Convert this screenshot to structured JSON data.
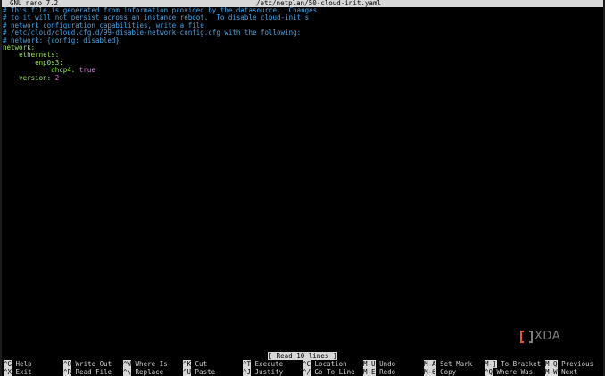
{
  "titlebar": {
    "app": "GNU nano 7.2",
    "file": "/etc/netplan/50-cloud-init.yaml"
  },
  "editor": {
    "lines": [
      {
        "text": "# This file is generated from information provided by the datasource.  Changes",
        "kind": "comment"
      },
      {
        "text": "# to it will not persist across an instance reboot.  To disable cloud-init's",
        "kind": "comment"
      },
      {
        "text": "# network configuration capabilities, write a file",
        "kind": "comment"
      },
      {
        "text": "# /etc/cloud/cloud.cfg.d/99-disable-network-config.cfg with the following:",
        "kind": "comment"
      },
      {
        "text": "# network: {config: disabled}",
        "kind": "comment"
      },
      {
        "key": "network",
        "sep": ":",
        "indent": "",
        "kind": "key"
      },
      {
        "key": "ethernets",
        "sep": ":",
        "indent": "    ",
        "kind": "key"
      },
      {
        "key": "enp0s3",
        "sep": ":",
        "indent": "        ",
        "kind": "key"
      },
      {
        "key": "dhcp4",
        "sep": ": ",
        "value": "true",
        "indent": "            ",
        "kind": "keyval"
      },
      {
        "key": "version",
        "sep": ": ",
        "value": "2",
        "indent": "    ",
        "kind": "keyval"
      }
    ]
  },
  "status": "[ Read 10 lines ]",
  "shortcuts": [
    [
      {
        "key": "^G",
        "label": "Help"
      },
      {
        "key": "^X",
        "label": "Exit"
      }
    ],
    [
      {
        "key": "^O",
        "label": "Write Out"
      },
      {
        "key": "^R",
        "label": "Read File"
      }
    ],
    [
      {
        "key": "^W",
        "label": "Where Is"
      },
      {
        "key": "^\\",
        "label": "Replace"
      }
    ],
    [
      {
        "key": "^K",
        "label": "Cut"
      },
      {
        "key": "^U",
        "label": "Paste"
      }
    ],
    [
      {
        "key": "^T",
        "label": "Execute"
      },
      {
        "key": "^J",
        "label": "Justify"
      }
    ],
    [
      {
        "key": "^C",
        "label": "Location"
      },
      {
        "key": "^/",
        "label": "Go To Line"
      }
    ],
    [
      {
        "key": "M-U",
        "label": "Undo"
      },
      {
        "key": "M-E",
        "label": "Redo"
      }
    ],
    [
      {
        "key": "M-A",
        "label": "Set Mark"
      },
      {
        "key": "M-6",
        "label": "Copy"
      }
    ],
    [
      {
        "key": "M-]",
        "label": "To Bracket"
      },
      {
        "key": "^Q",
        "label": "Where Was"
      }
    ],
    [
      {
        "key": "M-Q",
        "label": "Previous"
      },
      {
        "key": "M-W",
        "label": "Next"
      }
    ]
  ],
  "watermark": {
    "text": "XDA"
  },
  "colors": {
    "comment": "#4aa3e6",
    "key": "#9ae66b",
    "value": "#e27ae0",
    "bar": "#d8d8d8"
  }
}
